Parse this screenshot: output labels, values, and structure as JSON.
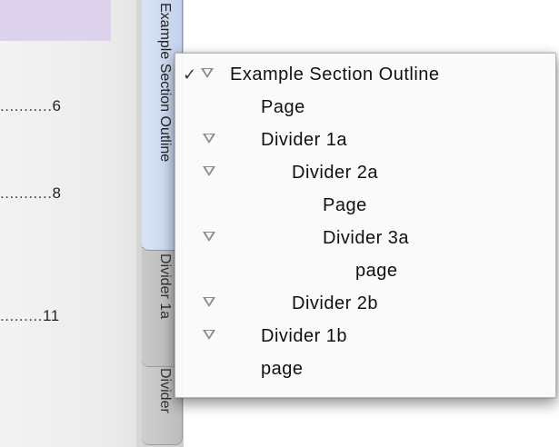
{
  "page": {
    "toc_entries": [
      {
        "dots": "...........",
        "page": "6"
      },
      {
        "dots": "...........",
        "page": "8"
      },
      {
        "dots": ".........",
        "page": "11"
      }
    ]
  },
  "tabs": {
    "active_label": "Example Section Outline",
    "mid_label": "Divider 1a",
    "low_label": "Divider"
  },
  "menu": {
    "items": [
      {
        "label": "Example Section Outline",
        "checked": true,
        "expandable": true,
        "check_glyph": "✓"
      },
      {
        "label": "Page",
        "checked": false,
        "expandable": false
      },
      {
        "label": "Divider 1a",
        "checked": false,
        "expandable": true
      },
      {
        "label": "Divider 2a",
        "checked": false,
        "expandable": true
      },
      {
        "label": "Page",
        "checked": false,
        "expandable": false
      },
      {
        "label": "Divider 3a",
        "checked": false,
        "expandable": true
      },
      {
        "label": "page",
        "checked": false,
        "expandable": false
      },
      {
        "label": "Divider 2b",
        "checked": false,
        "expandable": true
      },
      {
        "label": "Divider 1b",
        "checked": false,
        "expandable": true
      },
      {
        "label": "page",
        "checked": false,
        "expandable": false
      }
    ]
  },
  "colors": {
    "active_tab": "#c4d2ec",
    "page_highlight": "#ddd3ec",
    "triangle": "#8a8a8a"
  }
}
